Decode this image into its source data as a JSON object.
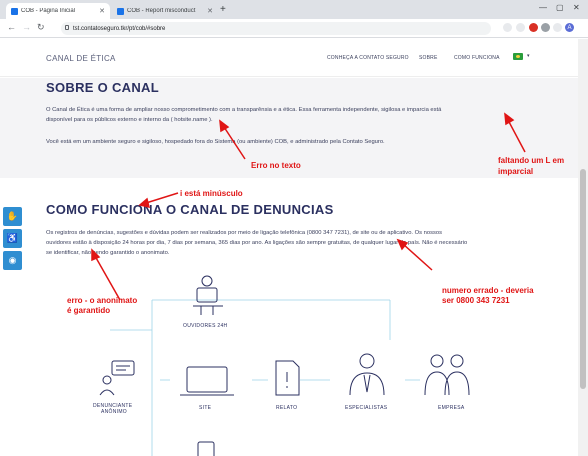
{
  "browser": {
    "tabs": [
      {
        "label": "COB - Página Inicial",
        "favicon_color": "#1a73e8"
      },
      {
        "label": "COB - Report misconduct",
        "favicon_color": "#1a73e8"
      }
    ],
    "url": "tst.contatoseguro.tkr/pt/cob/#sobre",
    "profile_initial": "A"
  },
  "header": {
    "brand": "CANAL DE ÉTICA",
    "menu": [
      "CONHEÇA A CONTATO SEGURO",
      "SOBRE",
      "COMO FUNCIONA"
    ]
  },
  "sobre": {
    "title": "SOBRE O CANAL",
    "p1_line1": "O Canal de Ética é uma forma de ampliar nosso comprometimento com a transparênsia e a ética. Essa ferramenta independente, sigilosa e imparcia está",
    "p1_line2": "disponível para os públicos externo e interno da ( hotsite.name ).",
    "p2": "Você está em um ambiente seguro e sigiloso, hospedado fora do Sistema (ou ambiente) COB, e administrado pela Contato Seguro."
  },
  "como": {
    "title": "COMO FUNCIONA O CANAL DE DENUNCIAS",
    "line1": "Os registros de denúncias, sugestões e dúvidas podem ser realizados por meio de ligação telefônica (0800 347 7231), de site ou de aplicativo. Os nossos",
    "line2": "ouvidores estão à disposição 24 horas por dia, 7 dias por semana, 365 dias por ano. As ligações são sempre gratuitas, de qualquer lugar do país. Não é necessário",
    "line3": "se identificar, não sendo garantido o anonimato."
  },
  "diagram": {
    "ouvidores": "OUVIDORES 24H",
    "denunciante_1": "DENUNCIANTE",
    "denunciante_2": "ANÔNIMO",
    "site": "SITE",
    "relato": "RELATO",
    "especialistas": "ESPECIALISTAS",
    "empresa": "EMPRESA"
  },
  "annotations": {
    "erro_texto": "Erro no texto",
    "faltando_1": "faltando um L em",
    "faltando_2": "imparcial",
    "i_minusculo": "i está minúsculo",
    "anon_1": "erro - o anonimato",
    "anon_2": "é garantido",
    "num_1": "numero errado - deveria",
    "num_2": "ser 0800 343 7231",
    "color": "#e01515"
  },
  "accessibility_buttons": [
    "sign-language-icon",
    "audio-description-icon",
    "low-vision-icon"
  ]
}
